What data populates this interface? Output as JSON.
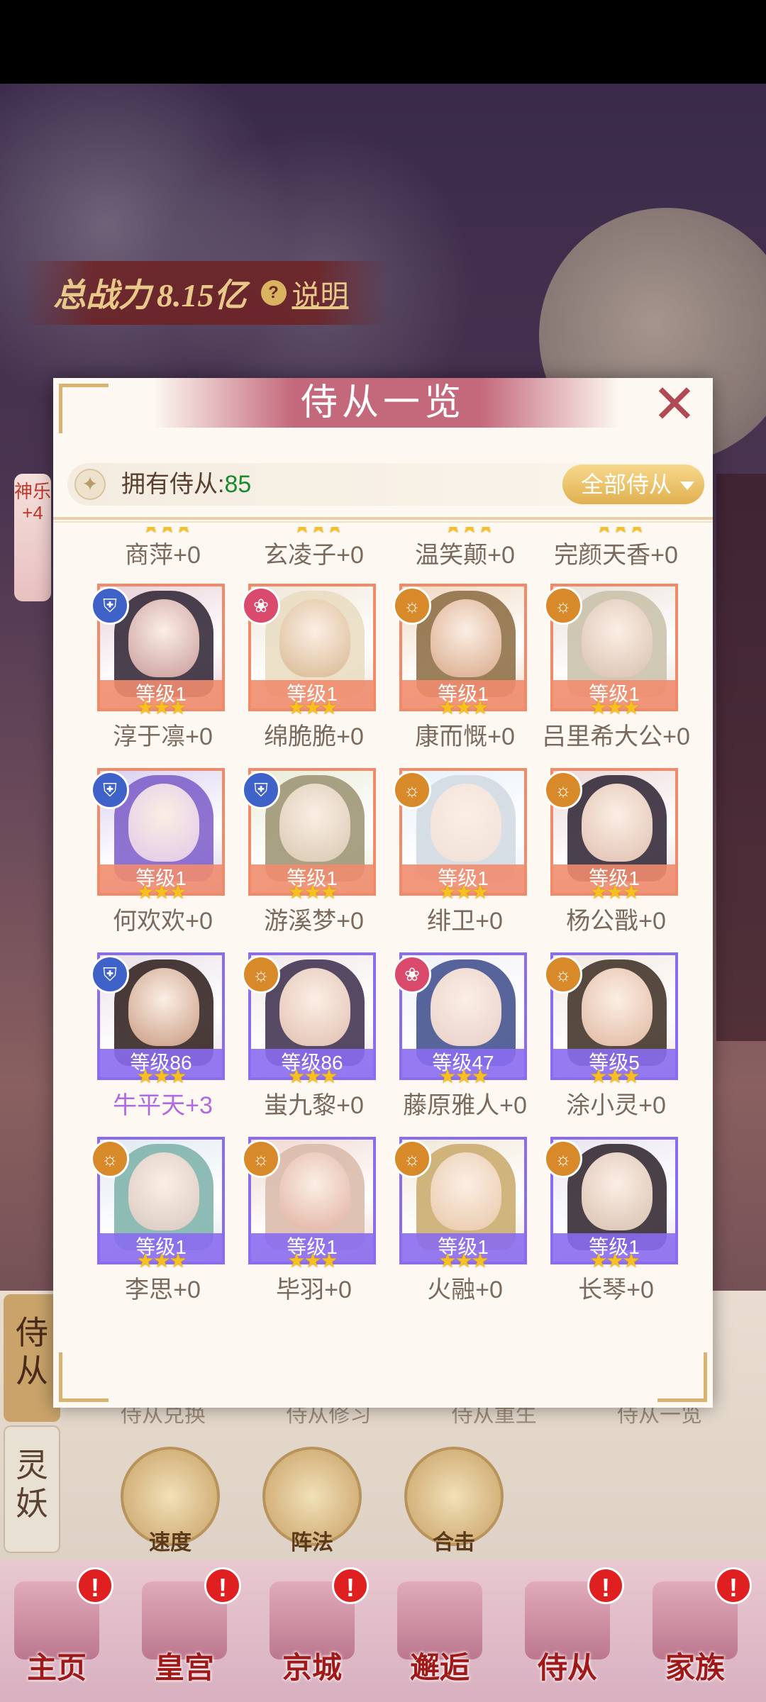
{
  "background": {
    "power_label": "总战力",
    "power_value": "8.15亿",
    "help_icon": "?",
    "help_label": "说明",
    "left_side_text": "神乐+4"
  },
  "lower_menu": {
    "tab_shicong": "侍从",
    "tab_lingyao": "灵妖",
    "subtabs": [
      "侍从兑换",
      "侍从修习",
      "侍从重生",
      "侍从一览"
    ],
    "skills": [
      "速度",
      "阵法",
      "合击"
    ]
  },
  "bottom_nav": [
    {
      "label": "主页",
      "alert": "!"
    },
    {
      "label": "皇宫",
      "alert": "!"
    },
    {
      "label": "京城",
      "alert": "!"
    },
    {
      "label": "邂逅",
      "alert": ""
    },
    {
      "label": "侍从",
      "alert": "!"
    },
    {
      "label": "家族",
      "alert": "!"
    }
  ],
  "modal": {
    "title": "侍从一览",
    "close_icon": "✕",
    "count_label": "拥有侍从:",
    "count_value": "85",
    "filter_label": "全部侍从",
    "partial_row": [
      "商萍+0",
      "玄凌子+0",
      "温笑颠+0",
      "完颜天香+0"
    ],
    "rows": [
      [
        {
          "name": "淳于凛+0",
          "level": "等级1",
          "badge": "shield",
          "frame": "orange"
        },
        {
          "name": "绵脆脆+0",
          "level": "等级1",
          "badge": "lotus",
          "frame": "orange"
        },
        {
          "name": "康而慨+0",
          "level": "等级1",
          "badge": "sun",
          "frame": "orange"
        },
        {
          "name": "吕里希大公+0",
          "level": "等级1",
          "badge": "sun",
          "frame": "orange"
        }
      ],
      [
        {
          "name": "何欢欢+0",
          "level": "等级1",
          "badge": "shield",
          "frame": "orange"
        },
        {
          "name": "游溪梦+0",
          "level": "等级1",
          "badge": "shield",
          "frame": "orange"
        },
        {
          "name": "绯卫+0",
          "level": "等级1",
          "badge": "sun",
          "frame": "orange"
        },
        {
          "name": "杨公戬+0",
          "level": "等级1",
          "badge": "sun",
          "frame": "orange"
        }
      ],
      [
        {
          "name": "牛平天+3",
          "level": "等级86",
          "badge": "shield",
          "frame": "purple",
          "highlight": true
        },
        {
          "name": "蚩九黎+0",
          "level": "等级86",
          "badge": "sun",
          "frame": "purple"
        },
        {
          "name": "藤原雅人+0",
          "level": "等级47",
          "badge": "lotus",
          "frame": "purple"
        },
        {
          "name": "涂小灵+0",
          "level": "等级5",
          "badge": "sun",
          "frame": "purple"
        }
      ],
      [
        {
          "name": "李思+0",
          "level": "等级1",
          "badge": "sun",
          "frame": "purple"
        },
        {
          "name": "毕羽+0",
          "level": "等级1",
          "badge": "sun",
          "frame": "purple"
        },
        {
          "name": "火融+0",
          "level": "等级1",
          "badge": "sun",
          "frame": "purple"
        },
        {
          "name": "长琴+0",
          "level": "等级1",
          "badge": "sun",
          "frame": "purple"
        }
      ]
    ],
    "stars": "★★★"
  },
  "colors": {
    "title_band": "#c4697c",
    "count_value": "#1b8a2f",
    "frame_orange": "#f08a68",
    "frame_purple": "#8a6cf0",
    "name_highlight": "#b06ae0",
    "filter_button": "#e0b050"
  }
}
